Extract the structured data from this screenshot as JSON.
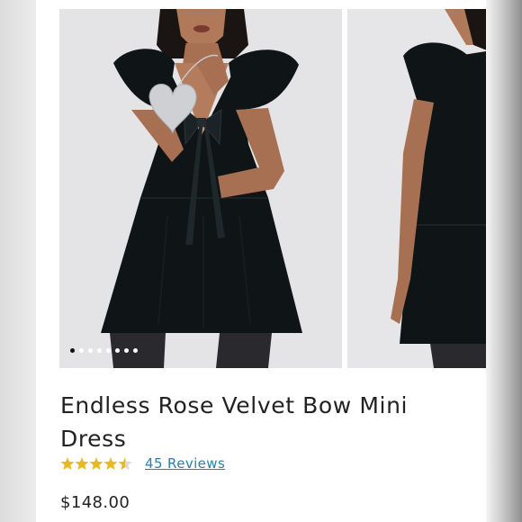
{
  "product": {
    "title": "Endless Rose Velvet Bow Mini Dress",
    "rating": 4.5,
    "rating_max": 5,
    "reviews_label": "45 Reviews",
    "price": "$148.00"
  },
  "gallery": {
    "image_count": 8,
    "active_index": 0
  },
  "colors": {
    "star": "#e8b923",
    "link": "#2a7fa8",
    "dress": "#0f1416"
  },
  "icons": [
    "star-icon",
    "carousel-dot"
  ]
}
